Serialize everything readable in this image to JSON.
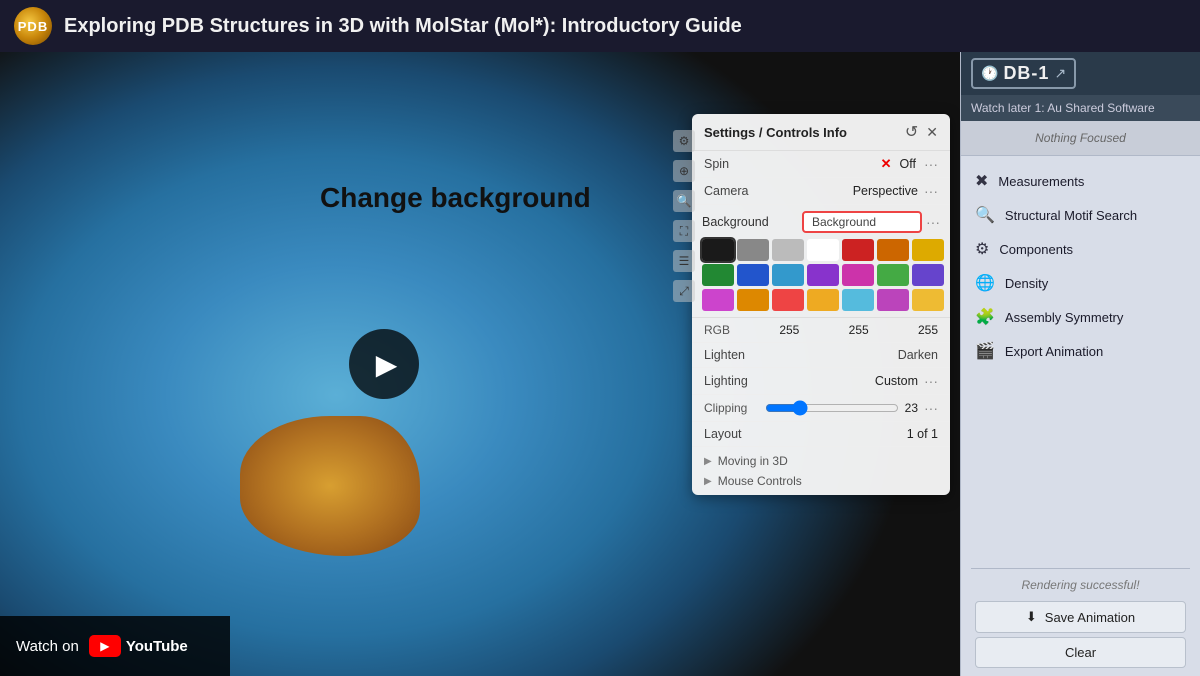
{
  "header": {
    "logo_text": "PDB",
    "title": "Exploring PDB Structures in 3D with MolStar (Mol*): Introductory Guide"
  },
  "video": {
    "change_bg_text": "Change background",
    "watch_on": "Watch on",
    "youtube": "YouTube"
  },
  "settings": {
    "title": "Settings / Controls Info",
    "close_icon": "✕",
    "spin_label": "Spin",
    "spin_x": "✕",
    "spin_value": "Off",
    "camera_label": "Camera",
    "camera_value": "Perspective",
    "bg_label": "Background",
    "bg_input_value": "Background",
    "rgb_label": "RGB",
    "rgb_r": "255",
    "rgb_g": "255",
    "rgb_b": "255",
    "lighten_label": "Lighten",
    "darken_label": "Darken",
    "lighting_label": "Lighting",
    "lighting_value": "Custom",
    "clipping_label": "Clipping",
    "clipping_value": "23",
    "layout_label": "Layout",
    "layout_value": "1 of 1",
    "expand1": "Moving in 3D",
    "expand2": "Mouse Controls",
    "dots": "···"
  },
  "color_swatches": [
    {
      "color": "#1a1a1a",
      "selected": true
    },
    {
      "color": "#888888",
      "selected": false
    },
    {
      "color": "#bbbbbb",
      "selected": false
    },
    {
      "color": "#ffffff",
      "selected": false
    },
    {
      "color": "#cc2222",
      "selected": false
    },
    {
      "color": "#cc6600",
      "selected": false
    },
    {
      "color": "#ddaa00",
      "selected": false
    },
    {
      "color": "#228833",
      "selected": false
    },
    {
      "color": "#2255cc",
      "selected": false
    },
    {
      "color": "#3399cc",
      "selected": false
    },
    {
      "color": "#8833cc",
      "selected": false
    },
    {
      "color": "#cc33aa",
      "selected": false
    },
    {
      "color": "#44aa44",
      "selected": false
    },
    {
      "color": "#6644cc",
      "selected": false
    },
    {
      "color": "#cc44cc",
      "selected": false
    },
    {
      "color": "#dd8800",
      "selected": false
    },
    {
      "color": "#ee4444",
      "selected": false
    },
    {
      "color": "#eeaa22",
      "selected": false
    },
    {
      "color": "#55bbdd",
      "selected": false
    },
    {
      "color": "#bb44bb",
      "selected": false
    },
    {
      "color": "#eebb33",
      "selected": false
    }
  ],
  "right_sidebar": {
    "db_label": "DB-1",
    "watch_label": "Watch later 1: Au Shared Software",
    "nothing_focused": "Nothing Focused",
    "items": [
      {
        "icon": "✖",
        "label": "Measurements"
      },
      {
        "icon": "🔍",
        "label": "Structural Motif Search"
      },
      {
        "icon": "⚙",
        "label": "Components"
      },
      {
        "icon": "🌐",
        "label": "Density"
      },
      {
        "icon": "🧩",
        "label": "Assembly Symmetry"
      },
      {
        "icon": "🎬",
        "label": "Export Animation"
      }
    ],
    "rendering_text": "Rendering successful!",
    "save_anim_icon": "⬇",
    "save_anim_label": "Save Animation",
    "clear_label": "Clear"
  }
}
